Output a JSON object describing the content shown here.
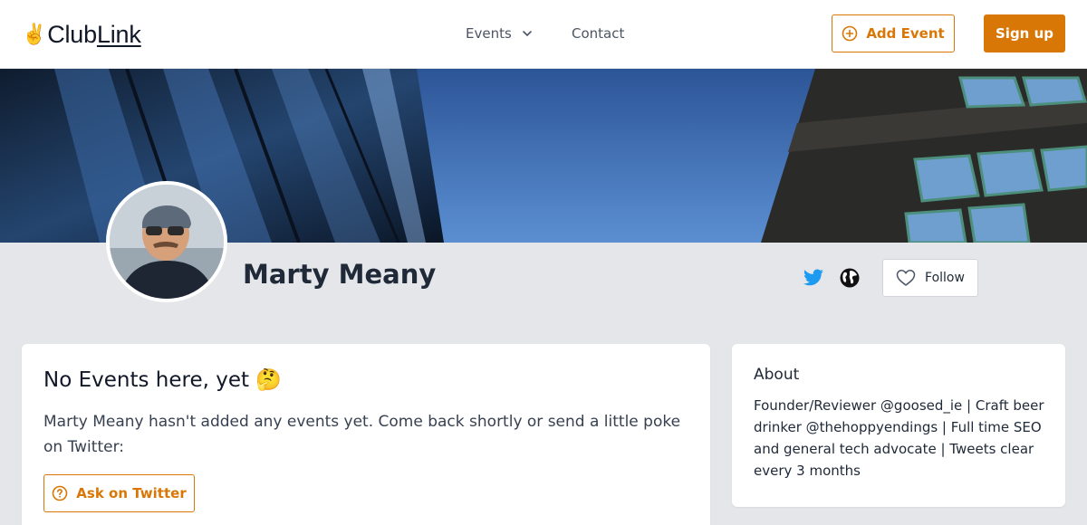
{
  "header": {
    "logo_prefix": "Club",
    "logo_suffix": "Link",
    "logo_icon": "victory-hand-emoji",
    "nav": {
      "events_label": "Events",
      "contact_label": "Contact"
    },
    "add_event_label": "Add Event",
    "sign_up_label": "Sign up"
  },
  "profile": {
    "name": "Marty Meany",
    "social_icons": [
      "twitter-icon",
      "globe-icon"
    ],
    "follow_label": "Follow"
  },
  "events_card": {
    "title": "No Events here, yet 🤔",
    "message": "Marty Meany hasn't added any events yet. Come back shortly or send a little poke on Twitter:",
    "ask_button_label": "Ask on Twitter"
  },
  "about_card": {
    "title": "About",
    "bio": "Founder/Reviewer @goosed_ie | Craft beer drinker @thehoppyendings | Full time SEO and general tech advocate | Tweets clear every 3 months"
  },
  "colors": {
    "accent": "#d97706",
    "twitter": "#1d9bf0",
    "page_background": "#e4e6ea"
  }
}
